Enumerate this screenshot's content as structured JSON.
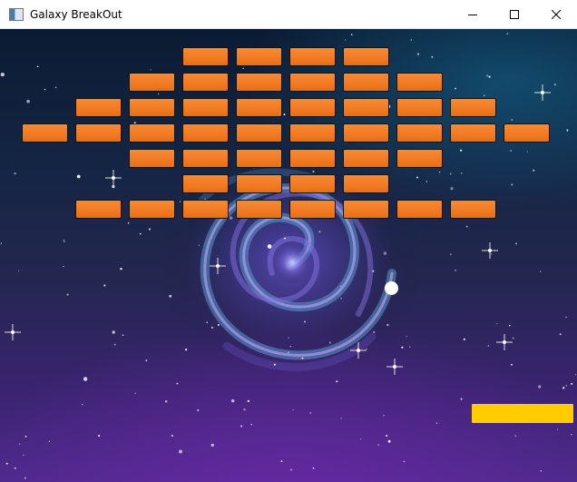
{
  "window": {
    "title": "Galaxy BreakOut",
    "icon": "app-window-icon",
    "controls": [
      "minimize-icon",
      "maximize-icon",
      "close-icon"
    ]
  },
  "game": {
    "background": "galaxy-spiral-starfield",
    "colors": {
      "brick": "#f07a22",
      "brick_border": "#1a1208",
      "ball": "#ffffff",
      "paddle": "#ffcc00"
    },
    "brick_rows": [
      {
        "row": 1,
        "first_column": 4,
        "count": 4
      },
      {
        "row": 2,
        "first_column": 3,
        "count": 6
      },
      {
        "row": 3,
        "first_column": 2,
        "count": 8
      },
      {
        "row": 4,
        "first_column": 1,
        "count": 10
      },
      {
        "row": 5,
        "first_column": 3,
        "count": 6
      },
      {
        "row": 6,
        "first_column": 4,
        "count": 4
      },
      {
        "row": 7,
        "first_column": 2,
        "count": 8
      }
    ]
  }
}
